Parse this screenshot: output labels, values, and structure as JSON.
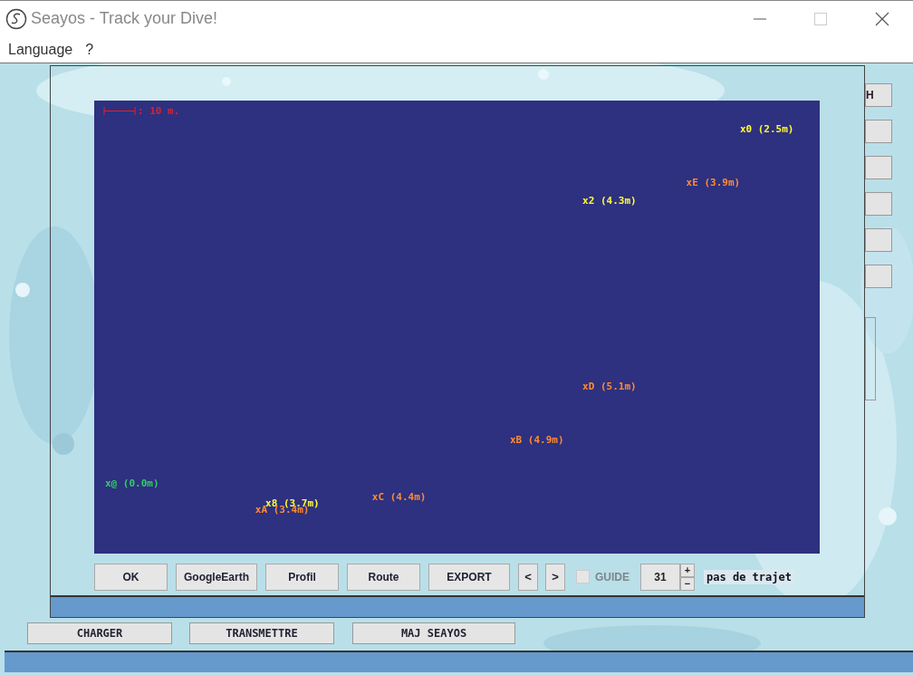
{
  "window": {
    "title": "Seayos - Track your Dive!"
  },
  "menu": [
    {
      "label": "Language"
    },
    {
      "label": "?"
    }
  ],
  "background_app": {
    "side_button_label": "H",
    "bottom_buttons": [
      "CHARGER",
      "TRANSMETTRE",
      "MAJ SEAYOS"
    ]
  },
  "dialog": {
    "scale_label": ": 10 m.",
    "waypoints": [
      {
        "label": "x0 (2.5m)",
        "color": "#ffff33"
      },
      {
        "label": "xE (3.9m)",
        "color": "#ff8c33"
      },
      {
        "label": "x2 (4.3m)",
        "color": "#ffff33"
      },
      {
        "label": "xD (5.1m)",
        "color": "#ff8c33"
      },
      {
        "label": "xB (4.9m)",
        "color": "#ff8c33"
      },
      {
        "label": "x@ (0.0m)",
        "color": "#33cc66"
      },
      {
        "label": "xA (3.4m)",
        "color": "#ff8c33"
      },
      {
        "label": "x8 (3.7m)",
        "color": "#ffff33"
      },
      {
        "label": "xC (4.4m)",
        "color": "#ff8c33"
      }
    ],
    "buttons": [
      "OK",
      "GoogleEarth",
      "Profil",
      "Route",
      "EXPORT"
    ],
    "prev": "<",
    "next": ">",
    "guide": {
      "label": "GUIDE",
      "checked": false,
      "disabled": true
    },
    "step": {
      "value": "31",
      "up": "+",
      "down": "−"
    },
    "step_label": "pas de trajet"
  }
}
